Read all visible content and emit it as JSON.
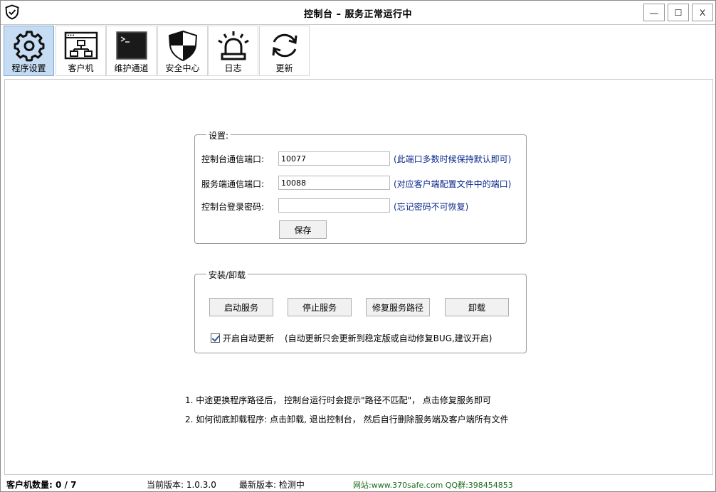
{
  "window": {
    "title": "控制台 – 服务正常运行中",
    "min_label": "—",
    "max_label": "☐",
    "close_label": "X"
  },
  "toolbar": {
    "items": [
      {
        "label": "程序设置",
        "icon": "gear-icon",
        "active": true
      },
      {
        "label": "客户机",
        "icon": "network-window-icon",
        "active": false
      },
      {
        "label": "维护通道",
        "icon": "terminal-icon",
        "active": false
      },
      {
        "label": "安全中心",
        "icon": "shield-icon",
        "active": false
      },
      {
        "label": "日志",
        "icon": "alarm-light-icon",
        "active": false
      },
      {
        "label": "更新",
        "icon": "refresh-icon",
        "active": false
      }
    ]
  },
  "settings": {
    "group_title": "设置:",
    "console_port_label": "控制台通信端口:",
    "console_port_value": "10077",
    "console_port_hint": "(此端口多数时候保持默认即可)",
    "server_port_label": "服务端通信端口:",
    "server_port_value": "10088",
    "server_port_hint": "(对应客户端配置文件中的端口)",
    "password_label": "控制台登录密码:",
    "password_value": "",
    "password_hint": "(忘记密码不可恢复)",
    "save_label": "保存"
  },
  "install": {
    "group_title": "安装/卸载",
    "start_label": "启动服务",
    "stop_label": "停止服务",
    "repair_label": "修复服务路径",
    "uninstall_label": "卸载",
    "auto_update_label": "开启自动更新",
    "auto_update_checked": true,
    "auto_update_hint": "(自动更新只会更新到稳定版或自动修复BUG,建议开启)"
  },
  "notes": [
    "1.  中途更换程序路径后， 控制台运行时会提示\"路径不匹配\"， 点击修复服务即可",
    "2.  如何彻底卸载程序:   点击卸载, 退出控制台， 然后自行删除服务端及客户端所有文件"
  ],
  "status": {
    "clients": "客户机数量: 0 / 7",
    "current_version": "当前版本: 1.0.3.0",
    "latest_version": "最新版本: 检测中",
    "website": "网站:www.370safe.com QQ群:398454853"
  },
  "colors": {
    "active_tool_bg": "#c5dcf2",
    "hint_text": "#0b2a8c",
    "website_text": "#1d6b1d"
  }
}
